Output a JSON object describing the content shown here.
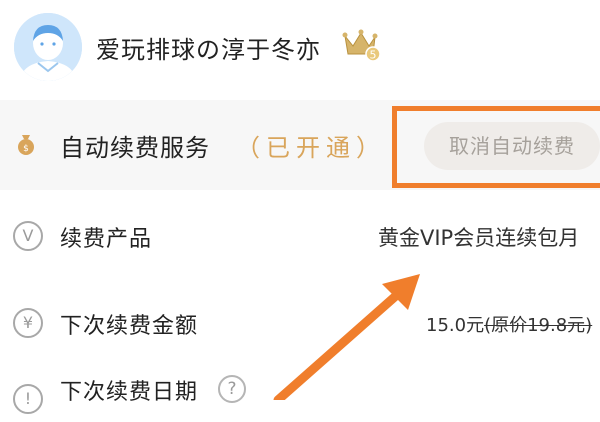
{
  "user": {
    "name": "爱玩排球の淳于冬亦",
    "badge_icon": "vip-crown-icon",
    "badge_level": "5"
  },
  "service": {
    "label": "自动续费服务",
    "status": "（已开通）",
    "icon": "coin-icon",
    "cancel_label": "取消自动续费"
  },
  "details": [
    {
      "icon": "v-circle-icon",
      "label": "续费产品",
      "value": "黄金VIP会员连续包月"
    },
    {
      "icon": "yen-circle-icon",
      "label": "下次续费金额",
      "value_price": "15.0元",
      "value_original": "(原价19.8元)"
    },
    {
      "icon": "clock-icon",
      "label": "下次续费日期"
    }
  ],
  "colors": {
    "accent_orange": "#f07e2c",
    "status_gold": "#d9a55b",
    "button_bg": "#efece9"
  }
}
